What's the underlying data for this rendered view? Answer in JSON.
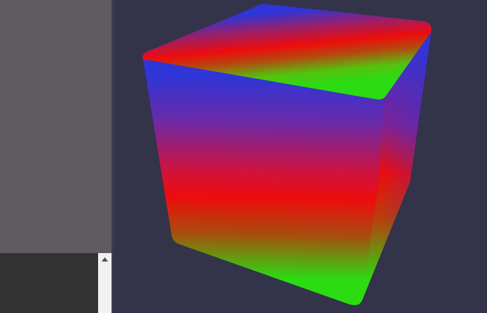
{
  "colors": {
    "background": "#33334a",
    "panel": "#605b61",
    "console": "#333333",
    "scrollbar": "#f1f1f1",
    "cube_red": "#ee0c0c",
    "cube_green": "#2bdc12",
    "cube_blue": "#2f35d6"
  },
  "icons": {
    "scroll_up": "triangle-up"
  }
}
